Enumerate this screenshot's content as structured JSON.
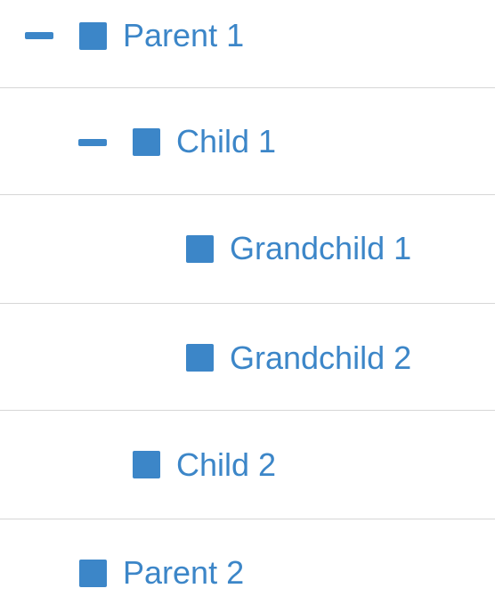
{
  "theme": {
    "accent_color": "#3c86c8",
    "divider_color": "#d6d6d6",
    "background": "#ffffff"
  },
  "tree": {
    "nodes": [
      {
        "label": "Parent 1",
        "level": 0,
        "expanded": true,
        "has_children": true,
        "icon": "square-node-icon",
        "toggle_icon": "collapse-minus-icon"
      },
      {
        "label": "Child 1",
        "level": 1,
        "expanded": true,
        "has_children": true,
        "icon": "square-node-icon",
        "toggle_icon": "collapse-minus-icon"
      },
      {
        "label": "Grandchild 1",
        "level": 2,
        "has_children": false,
        "icon": "square-node-icon"
      },
      {
        "label": "Grandchild 2",
        "level": 2,
        "has_children": false,
        "icon": "square-node-icon"
      },
      {
        "label": "Child 2",
        "level": 1,
        "has_children": false,
        "icon": "square-node-icon"
      },
      {
        "label": "Parent 2",
        "level": 0,
        "has_children": false,
        "icon": "square-node-icon"
      }
    ]
  }
}
